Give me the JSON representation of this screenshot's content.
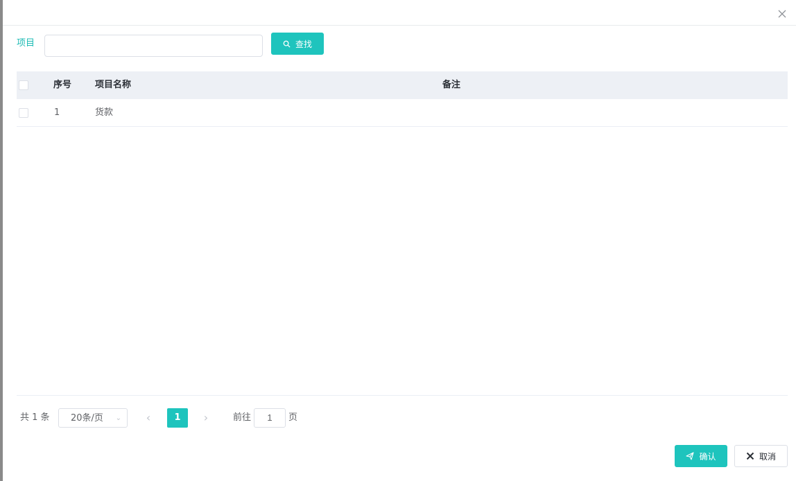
{
  "dialog": {
    "close_icon": "close-icon"
  },
  "filter": {
    "label": "项目",
    "input_value": "",
    "search_label": "查找",
    "search_icon": "search-icon"
  },
  "table": {
    "columns": [
      "序号",
      "项目名称",
      "备注"
    ],
    "rows": [
      {
        "index": "1",
        "name": "货款",
        "remark": ""
      }
    ]
  },
  "pagination": {
    "total": "共 1 条",
    "page_size": "20条/页",
    "current_page": "1",
    "goto_prefix": "前往",
    "goto_value": "1",
    "goto_suffix": "页"
  },
  "footer": {
    "confirm_label": "确认",
    "confirm_icon": "send-icon",
    "cancel_label": "取消",
    "cancel_icon": "close-icon"
  },
  "colors": {
    "accent": "#1ec4bd",
    "header_bg": "#edf0f5"
  }
}
